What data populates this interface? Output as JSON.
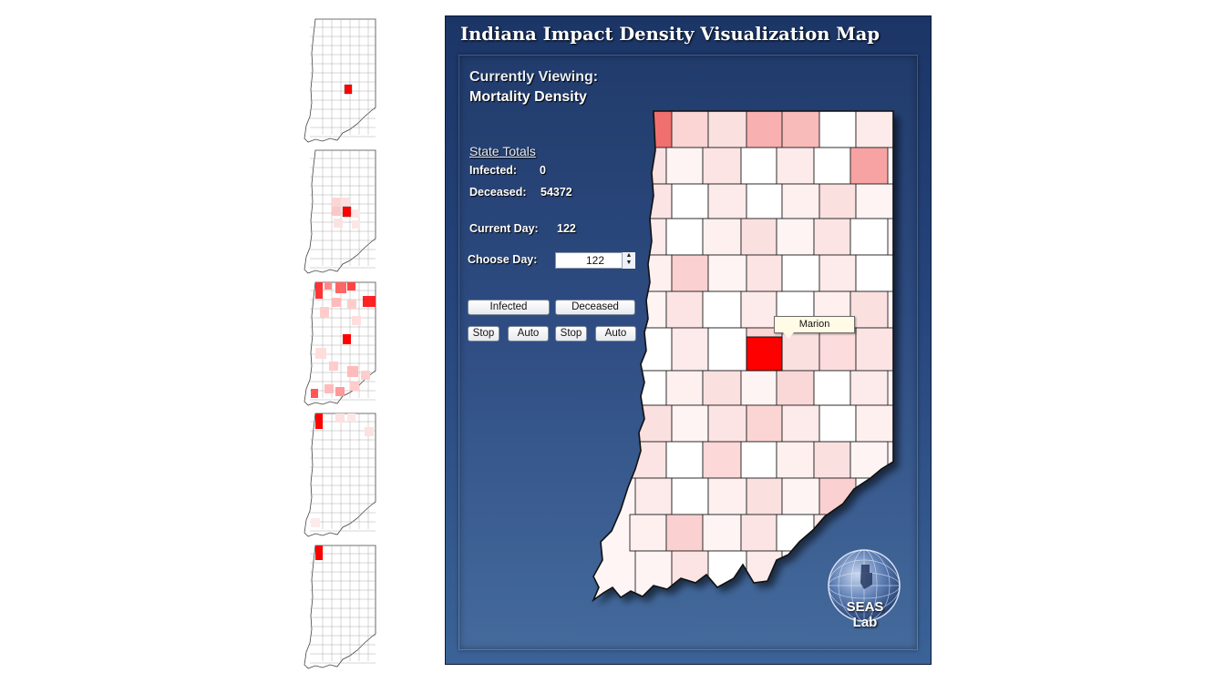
{
  "title": "Indiana Impact Density Visualization Map",
  "viewing": {
    "heading": "Currently Viewing:",
    "mode": "Mortality Density"
  },
  "totals": {
    "heading": "State Totals",
    "infected_label": "Infected:",
    "infected_value": "0",
    "deceased_label": "Deceased:",
    "deceased_value": "54372"
  },
  "day": {
    "current_label": "Current Day:",
    "current_value": "122",
    "choose_label": "Choose Day:",
    "choose_value": "122"
  },
  "buttons": {
    "infected": "Infected",
    "deceased": "Deceased",
    "stop_infected": "Stop",
    "auto_infected": "Auto",
    "stop_deceased": "Stop",
    "auto_deceased": "Auto"
  },
  "tooltip": "Marion",
  "logo_text": "SEAS Lab",
  "colors": {
    "panel": "#26457c",
    "highlight": "#ff0000",
    "light": "#fdeaea",
    "medium": "#f7a8a8"
  }
}
